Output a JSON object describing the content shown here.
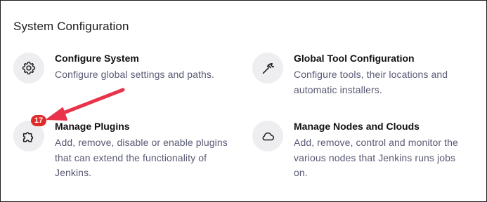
{
  "section": {
    "title": "System Configuration"
  },
  "cards": [
    {
      "title": "Configure System",
      "desc_lines": [
        "Configure global settings and paths."
      ],
      "icon": "gear-icon"
    },
    {
      "title": "Global Tool Configuration",
      "desc_lines": [
        "Configure tools, their locations and",
        "automatic installers."
      ],
      "icon": "hammer-icon"
    },
    {
      "title": "Manage Plugins",
      "desc_lines": [
        "Add, remove, disable or enable plugins",
        "that can extend the functionality of",
        "Jenkins."
      ],
      "icon": "puzzle-icon",
      "badge": "17"
    },
    {
      "title": "Manage Nodes and Clouds",
      "desc_lines": [
        "Add, remove, control and monitor the",
        "various nodes that Jenkins runs jobs",
        "on."
      ],
      "icon": "cloud-icon"
    }
  ],
  "colors": {
    "badge": "#e02b2b",
    "arrow": "#e8334a",
    "title_text": "#111114",
    "desc_text": "#595a74",
    "icon_bg": "#eeeef1"
  }
}
